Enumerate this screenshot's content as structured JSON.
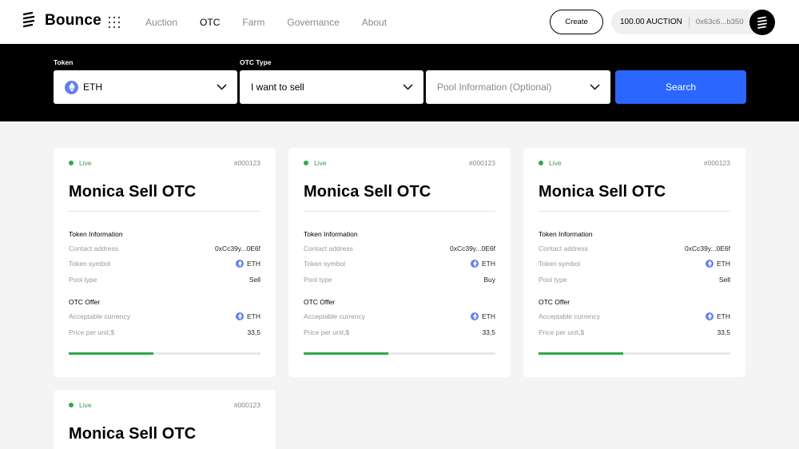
{
  "header": {
    "logo_text": "Bounce",
    "nav": [
      "Auction",
      "OTC",
      "Farm",
      "Governance",
      "About"
    ],
    "active_nav": "OTC",
    "create_label": "Create",
    "balance": "100.00 AUCTION",
    "address": "0x63c6...b350"
  },
  "search": {
    "token_label": "Token",
    "token_value": "ETH",
    "otc_type_label": "OTC Type",
    "otc_type_value": "I want to sell",
    "pool_info_placeholder": "Pool Information (Optional)",
    "search_label": "Search"
  },
  "cards": [
    {
      "status": "Live",
      "id": "#000123",
      "title": "Monica Sell OTC",
      "token_info_label": "Token Information",
      "contact_label": "Contact address",
      "contact_value": "0xCc39y...0E6f",
      "symbol_label": "Token symbol",
      "symbol_value": "ETH",
      "pool_type_label": "Pool type",
      "pool_type_value": "Sell",
      "otc_offer_label": "OTC Offer",
      "currency_label": "Acceptable currency",
      "currency_value": "ETH",
      "price_label": "Price per unit,$",
      "price_value": "33,5",
      "progress": 0.44
    },
    {
      "status": "Live",
      "id": "#000123",
      "title": "Monica Sell OTC",
      "token_info_label": "Token Information",
      "contact_label": "Contact address",
      "contact_value": "0xCc39y...0E6f",
      "symbol_label": "Token symbol",
      "symbol_value": "ETH",
      "pool_type_label": "Pool type",
      "pool_type_value": "Buy",
      "otc_offer_label": "OTC Offer",
      "currency_label": "Acceptable currency",
      "currency_value": "ETH",
      "price_label": "Price per unit,$",
      "price_value": "33,5",
      "progress": 0.44
    },
    {
      "status": "Live",
      "id": "#000123",
      "title": "Monica Sell OTC",
      "token_info_label": "Token Information",
      "contact_label": "Contact address",
      "contact_value": "0xCc39y...0E6f",
      "symbol_label": "Token symbol",
      "symbol_value": "ETH",
      "pool_type_label": "Pool type",
      "pool_type_value": "Sell",
      "otc_offer_label": "OTC Offer",
      "currency_label": "Acceptable currency",
      "currency_value": "ETH",
      "price_label": "Price per unit,$",
      "price_value": "33,5",
      "progress": 0.44
    },
    {
      "status": "Live",
      "id": "#000123",
      "title": "Monica Sell OTC"
    }
  ],
  "colors": {
    "accent": "#2a66ff",
    "live": "#2fa84f",
    "eth": "#627eea"
  },
  "icons": [
    "bounce-logo-icon",
    "apps-grid-icon",
    "chevron-down-icon",
    "eth-icon",
    "avatar-icon"
  ]
}
